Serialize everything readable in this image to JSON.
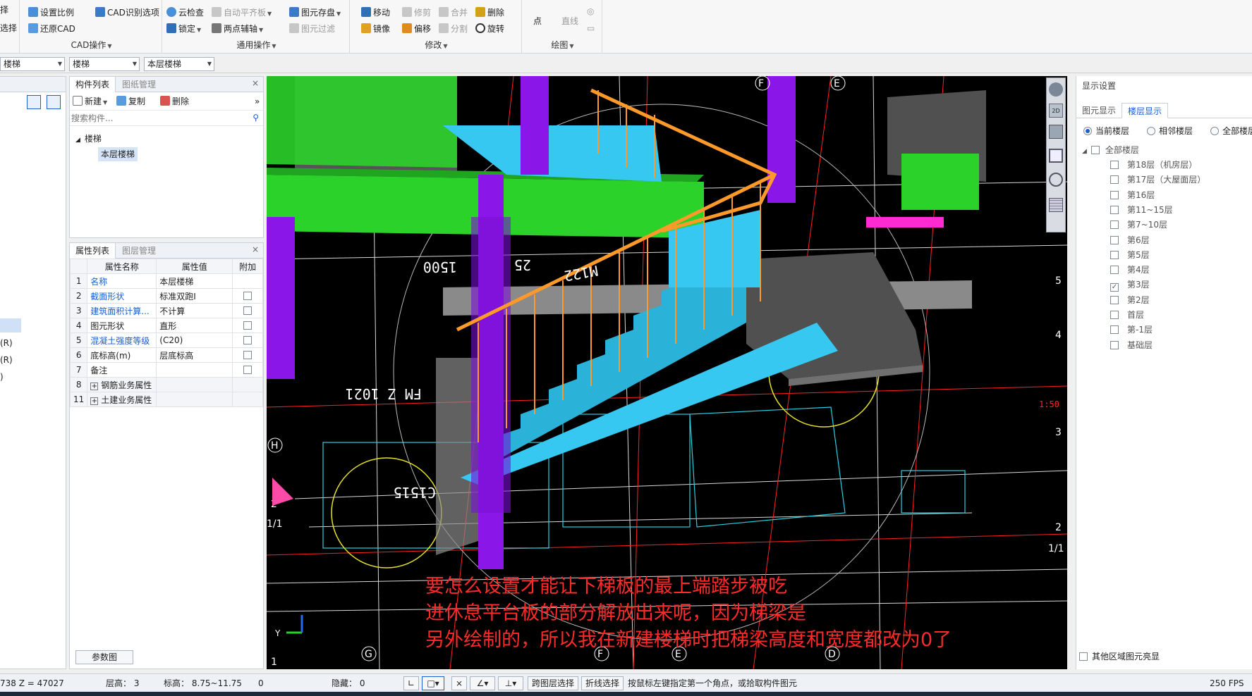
{
  "ribbon": {
    "left_partial": [
      "择",
      "选择"
    ],
    "cad_group": {
      "label": "CAD操作",
      "items": [
        "设置比例",
        "CAD识别选项",
        "还原CAD"
      ]
    },
    "general_group": {
      "label": "通用操作",
      "items": [
        "云检查",
        "自动平齐板",
        "图元存盘",
        "锁定",
        "两点辅轴",
        "图元过滤"
      ]
    },
    "modify_group": {
      "label": "修改",
      "items": [
        "移动",
        "修剪",
        "合并",
        "删除",
        "镜像",
        "偏移",
        "分割",
        "旋转"
      ]
    },
    "draw_group": {
      "label": "绘图",
      "items": [
        "点",
        "直线"
      ]
    }
  },
  "selectors": [
    "楼梯",
    "楼梯",
    "本层楼梯"
  ],
  "left_partial": [
    "(R)",
    "(R)",
    ")"
  ],
  "component_panel": {
    "tabs": [
      "构件列表",
      "图纸管理"
    ],
    "toolbar": [
      "新建",
      "复制",
      "删除"
    ],
    "search_placeholder": "搜索构件...",
    "tree_root": "楼梯",
    "tree_child": "本层楼梯"
  },
  "property_panel": {
    "tabs": [
      "属性列表",
      "图层管理"
    ],
    "headers": [
      "属性名称",
      "属性值",
      "附加"
    ],
    "rows": [
      {
        "n": "1",
        "name": "名称",
        "value": "本层楼梯",
        "blue": true,
        "check": false
      },
      {
        "n": "2",
        "name": "截面形状",
        "value": "标准双跑I",
        "blue": true,
        "check": true
      },
      {
        "n": "3",
        "name": "建筑面积计算...",
        "value": "不计算",
        "blue": true,
        "check": true
      },
      {
        "n": "4",
        "name": "图元形状",
        "value": "直形",
        "blue": false,
        "check": true
      },
      {
        "n": "5",
        "name": "混凝土强度等级",
        "value": "(C20)",
        "blue": true,
        "check": true
      },
      {
        "n": "6",
        "name": "底标高(m)",
        "value": "层底标高",
        "blue": false,
        "check": true
      },
      {
        "n": "7",
        "name": "备注",
        "value": "",
        "blue": false,
        "check": true
      },
      {
        "n": "8",
        "name": "钢筋业务属性",
        "value": "",
        "blue": false,
        "check": false,
        "expand": true
      },
      {
        "n": "11",
        "name": "土建业务属性",
        "value": "",
        "blue": false,
        "check": false,
        "expand": true
      }
    ],
    "footer_button": "参数图"
  },
  "viewport": {
    "caption": [
      "要怎么设置才能让下梯板的最上端踏步被吃",
      "进休息平台板的部分解放出来呢，因为梯梁是",
      "另外绘制的，所以我在新建楼梯时把梯梁高度和宽度都改为0了"
    ],
    "axis_labels": [
      "F",
      "E",
      "H",
      "G",
      "F",
      "E",
      "D",
      "5",
      "4",
      "3",
      "2",
      "1/1",
      "2",
      "1/1",
      "1"
    ],
    "cad_texts": [
      "1500",
      "FM Z 1021",
      "C1515",
      "M122",
      "25",
      "1:50"
    ]
  },
  "display_panel": {
    "title": "显示设置",
    "tabs": [
      "图元显示",
      "楼层显示"
    ],
    "modes": [
      "当前楼层",
      "相邻楼层",
      "全部楼层"
    ],
    "root": "全部楼层",
    "floors": [
      {
        "name": "第18层（机房层）",
        "checked": false
      },
      {
        "name": "第17层（大屋面层）",
        "checked": false
      },
      {
        "name": "第16层",
        "checked": false
      },
      {
        "name": "第11~15层",
        "checked": false
      },
      {
        "name": "第7~10层",
        "checked": false
      },
      {
        "name": "第6层",
        "checked": false
      },
      {
        "name": "第5层",
        "checked": false
      },
      {
        "name": "第4层",
        "checked": false
      },
      {
        "name": "第3层",
        "checked": true
      },
      {
        "name": "第2层",
        "checked": false
      },
      {
        "name": "首层",
        "checked": false
      },
      {
        "name": "第-1层",
        "checked": false
      },
      {
        "name": "基础层",
        "checked": false
      }
    ],
    "footer": "其他区域图元亮显"
  },
  "status": {
    "coords": "738 Z = 47027",
    "floor_height": "层高：  3",
    "elevation": "标高：  8.75~11.75",
    "zero": "0",
    "hidden": "隐藏：  0",
    "btn_cross": "跨图层选择",
    "btn_poly": "折线选择",
    "hint": "按鼠标左键指定第一个角点，或拾取构件图元",
    "fps": "250 FPS"
  },
  "colors": {
    "accent": "#1b5fd1",
    "caption": "#ff2a2a",
    "viewport_bg": "#000000"
  }
}
